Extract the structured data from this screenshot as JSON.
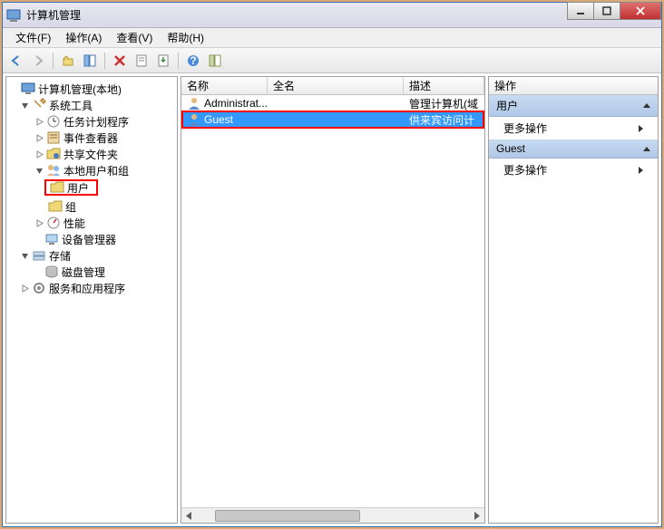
{
  "window": {
    "title": "计算机管理"
  },
  "menu": {
    "file": "文件(F)",
    "action": "操作(A)",
    "view": "查看(V)",
    "help": "帮助(H)"
  },
  "tree": {
    "root": "计算机管理(本地)",
    "system_tools": "系统工具",
    "task_scheduler": "任务计划程序",
    "event_viewer": "事件查看器",
    "shared_folders": "共享文件夹",
    "local_users_groups": "本地用户和组",
    "users": "用户",
    "groups": "组",
    "performance": "性能",
    "device_manager": "设备管理器",
    "storage": "存储",
    "disk_management": "磁盘管理",
    "services_apps": "服务和应用程序"
  },
  "list": {
    "col_name": "名称",
    "col_fullname": "全名",
    "col_desc": "描述",
    "rows": [
      {
        "name": "Administrat...",
        "fullname": "",
        "desc": "管理计算机(域"
      },
      {
        "name": "Guest",
        "fullname": "",
        "desc": "供来宾访问计"
      }
    ]
  },
  "actions": {
    "header": "操作",
    "section1": "用户",
    "more": "更多操作",
    "section2": "Guest"
  }
}
